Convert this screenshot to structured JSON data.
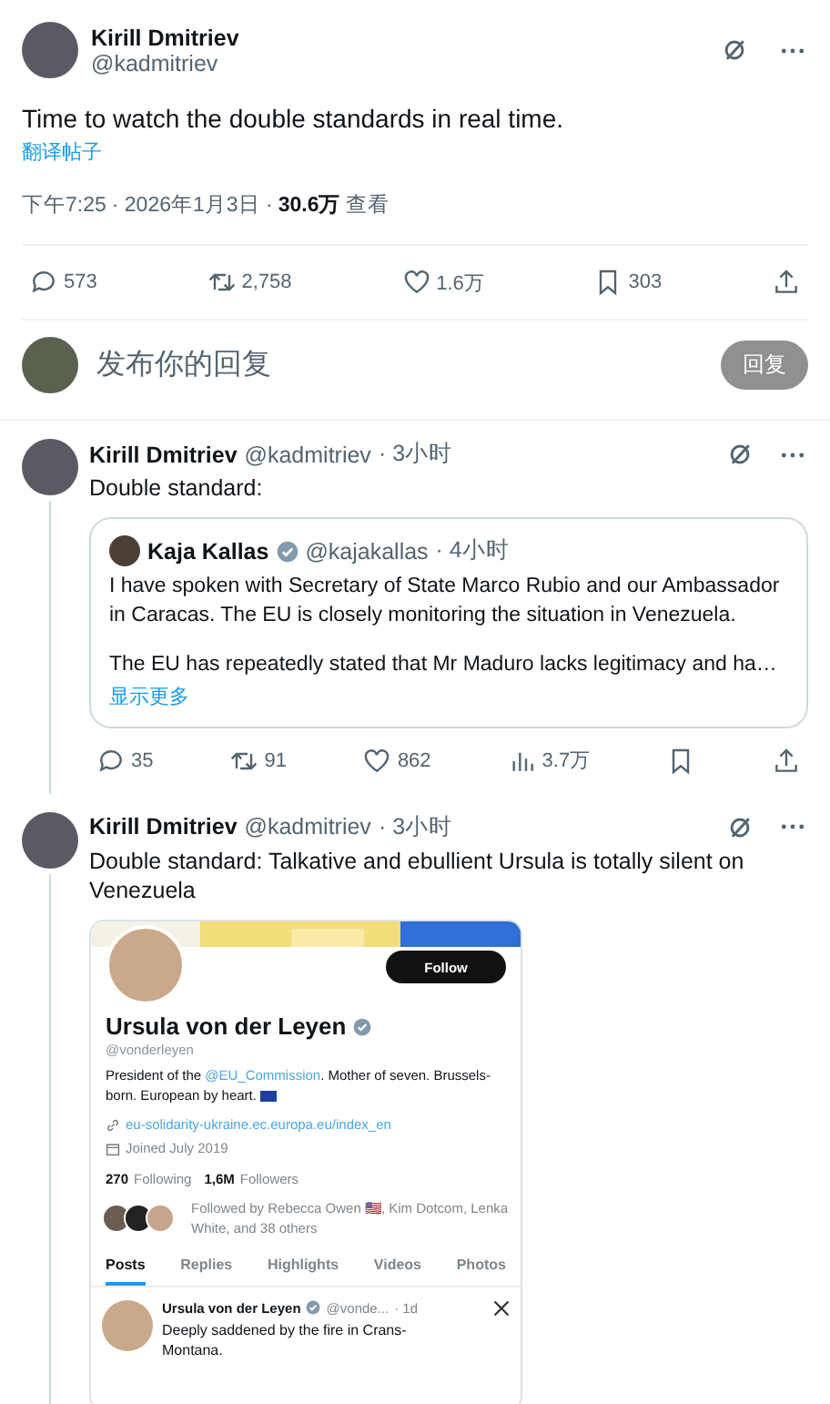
{
  "main_post": {
    "author": "Kirill Dmitriev",
    "handle": "@kadmitriev",
    "text": "Time to watch the double standards in real time.",
    "translate": "翻译帖子",
    "time": "下午7:25",
    "date": "· 2026年1月3日 ·",
    "views": "30.6万",
    "views_label": "查看",
    "stats": [
      {
        "kind": "reply",
        "value": "573"
      },
      {
        "kind": "repost",
        "value": "2,758"
      },
      {
        "kind": "like",
        "value": "1.6万"
      },
      {
        "kind": "bookmark",
        "value": "303"
      },
      {
        "kind": "share"
      }
    ]
  },
  "reply_box": {
    "placeholder": "发布你的回复",
    "button": "回复"
  },
  "replies": [
    {
      "author": "Kirill Dmitriev",
      "handle": "@kadmitriev",
      "time": "· 3小时",
      "text": "Double standard:",
      "quote": {
        "author": "Kaja Kallas",
        "verified": true,
        "handle": "@kajakallas",
        "time": "· 4小时",
        "paragraphs": [
          "I have spoken with Secretary of State Marco Rubio and our Ambassador in Caracas. The EU is closely monitoring the situation in Venezuela.",
          "The EU has repeatedly stated that Mr Maduro lacks legitimacy and ha…"
        ],
        "more": "显示更多"
      },
      "stats": [
        {
          "kind": "reply",
          "value": "35"
        },
        {
          "kind": "repost",
          "value": "91"
        },
        {
          "kind": "like",
          "value": "862"
        },
        {
          "kind": "views",
          "value": "3.7万"
        },
        {
          "kind": "bookmark"
        },
        {
          "kind": "share"
        }
      ]
    },
    {
      "author": "Kirill Dmitriev",
      "handle": "@kadmitriev",
      "time": "· 3小时",
      "text": "Double standard: Talkative and ebullient Ursula is totally silent on Venezuela",
      "screenshot": {
        "follow": "Follow",
        "name": "Ursula von der Leyen",
        "verified": true,
        "handle": "@vonderleyen",
        "bio_start": "President of the ",
        "bio_mention": "@EU_Commission",
        "bio_end": ". Mother of seven. Brussels-born. European by heart.",
        "link": "eu-solidarity-ukraine.ec.europa.eu/index_en",
        "joined": "Joined July 2019",
        "following_count": "270",
        "following_label": "Following",
        "followers_count": "1,6M",
        "followers_label": "Followers",
        "followed_by": "Followed by Rebecca Owen 🇺🇸, Kim Dotcom, Lenka White, and 38 others",
        "tabs": [
          {
            "label": "Posts",
            "selected": true
          },
          {
            "label": "Replies",
            "selected": false
          },
          {
            "label": "Highlights",
            "selected": false
          },
          {
            "label": "Videos",
            "selected": false
          },
          {
            "label": "Photos",
            "selected": false
          }
        ],
        "post": {
          "name": "Ursula von der Leyen",
          "verified": true,
          "handle": "@vonde...",
          "time": "· 1d",
          "text": "Deeply saddened by the fire in Crans-Montana."
        }
      }
    }
  ]
}
